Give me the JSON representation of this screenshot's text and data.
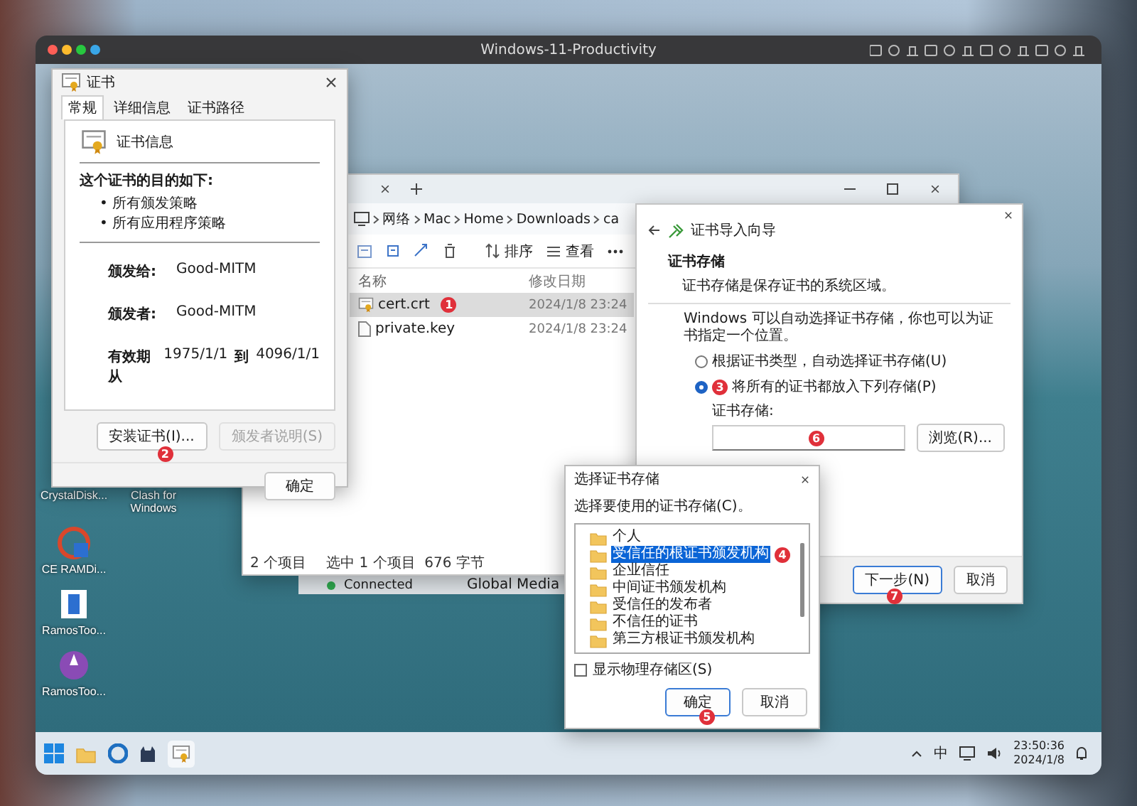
{
  "host_window": {
    "title": "Windows-11-Productivity"
  },
  "desktop_icons": [
    {
      "label": "CrystalDisk...",
      "kind": "hidden"
    },
    {
      "label": "Clash for Windows",
      "kind": "hidden"
    },
    {
      "label": "CE RAMDi...",
      "kind": "ramdisk"
    },
    {
      "label": "RamosToo...",
      "kind": "document"
    },
    {
      "label": "RamosToo...",
      "kind": "archive"
    }
  ],
  "background_window": {
    "status": "Connected",
    "name": "Global Media"
  },
  "certificate_dialog": {
    "title": "证书",
    "tabs": [
      {
        "label": "常规",
        "selected": true
      },
      {
        "label": "详细信息",
        "selected": false
      },
      {
        "label": "证书路径",
        "selected": false
      }
    ],
    "heading": "证书信息",
    "purpose_label": "这个证书的目的如下:",
    "purposes": [
      "• 所有颁发策略",
      "• 所有应用程序策略"
    ],
    "fields": [
      {
        "label": "颁发给:",
        "value": "Good-MITM"
      },
      {
        "label": "颁发者:",
        "value": "Good-MITM"
      }
    ],
    "validity": {
      "label": "有效期从",
      "from": "1975/1/1",
      "to_label": "到",
      "to": "4096/1/1"
    },
    "buttons": [
      {
        "label": "安装证书(I)...",
        "disabled": false,
        "badge": "2"
      },
      {
        "label": "颁发者说明(S)",
        "disabled": true
      }
    ],
    "ok_button": "确定"
  },
  "file_explorer": {
    "breadcrumb": [
      "网络",
      "Mac",
      "Home",
      "Downloads",
      "ca"
    ],
    "toolbar": [
      {
        "label": "排序"
      },
      {
        "label": "查看"
      }
    ],
    "columns": [
      "名称",
      "修改日期"
    ],
    "rows": [
      {
        "name": "cert.crt",
        "modified": "2024/1/8 23:24",
        "selected": true,
        "kind": "certificate",
        "badge": "1"
      },
      {
        "name": "private.key",
        "modified": "2024/1/8 23:24",
        "selected": false,
        "kind": "file"
      }
    ],
    "status": [
      "2 个项目",
      "选中 1 个项目  676 字节"
    ]
  },
  "import_wizard": {
    "title": "证书导入向导",
    "section_title": "证书存储",
    "section_text": "证书存储是保存证书的系统区域。",
    "intro": "Windows 可以自动选择证书存储，你也可以为证书指定一个位置。",
    "options": [
      {
        "label": "根据证书类型，自动选择证书存储(U)",
        "selected": false
      },
      {
        "label": "将所有的证书都放入下列存储(P)",
        "selected": true,
        "badge": "3"
      }
    ],
    "store_label": "证书存储:",
    "store_field_badge": "6",
    "browse_button": "浏览(R)...",
    "buttons": [
      {
        "label": "下一步(N)",
        "primary": true,
        "badge": "7"
      },
      {
        "label": "取消",
        "primary": false
      }
    ]
  },
  "store_dialog": {
    "title": "选择证书存储",
    "prompt": "选择要使用的证书存储(C)。",
    "stores": [
      {
        "label": "个人",
        "selected": false
      },
      {
        "label": "受信任的根证书颁发机构",
        "selected": true,
        "badge": "4"
      },
      {
        "label": "企业信任",
        "selected": false
      },
      {
        "label": "中间证书颁发机构",
        "selected": false
      },
      {
        "label": "受信任的发布者",
        "selected": false
      },
      {
        "label": "不信任的证书",
        "selected": false
      },
      {
        "label": "第三方根证书颁发机构",
        "selected": false
      }
    ],
    "show_physical": {
      "label": "显示物理存储区(S)",
      "checked": false
    },
    "buttons": [
      {
        "label": "确定",
        "primary": true,
        "badge": "5"
      },
      {
        "label": "取消",
        "primary": false
      }
    ]
  },
  "taskbar": {
    "input_method": "中",
    "time": "23:50:36",
    "date": "2024/1/8"
  }
}
